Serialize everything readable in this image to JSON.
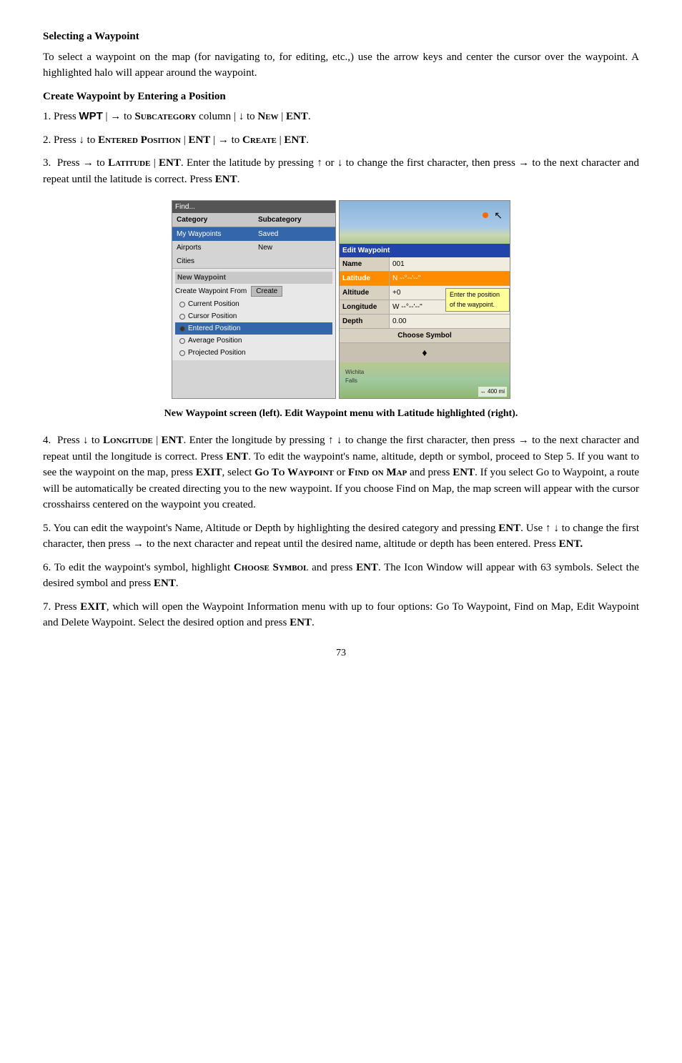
{
  "page": {
    "title": "Selecting a Waypoint",
    "section1": {
      "heading": "Selecting a Waypoint",
      "body": "To select a waypoint on the map (for navigating to, for editing, etc.,) use the arrow keys and center the cursor over the waypoint. A highlighted halo will appear around the waypoint."
    },
    "section2": {
      "heading": "Create Waypoint by Entering a Position",
      "step1": "1. Press WPT | → to Subcategory column | ↓ to New | ENT.",
      "step2": "2. Press ↓ to Entered Position | ENT | → to Create | ENT.",
      "step3_pre": "3.  Press → to",
      "step3_field": "Latitude | ENT",
      "step3_mid": ". Enter the latitude by pressing ↑ or ↓ to change the first character, then press → to the next character and repeat until the latitude is correct. Press",
      "step3_ent": "ENT",
      "step3_end": "."
    },
    "screenshot": {
      "left_panel": {
        "header": "Find...",
        "col1": "Category",
        "col2": "Subcategory",
        "rows": [
          {
            "cat": "My Waypoints",
            "sub": "Saved"
          },
          {
            "cat": "Airports",
            "sub": "New"
          },
          {
            "cat": "Cities",
            "sub": ""
          }
        ],
        "new_waypoint_title": "New Waypoint",
        "create_from_label": "Create Waypoint From",
        "create_button": "Create",
        "options": [
          {
            "label": "Current Position",
            "type": "radio"
          },
          {
            "label": "Cursor Position",
            "type": "radio"
          },
          {
            "label": "Entered Position",
            "type": "radio",
            "selected": true
          },
          {
            "label": "Average Position",
            "type": "radio"
          },
          {
            "label": "Projected Position",
            "type": "radio"
          }
        ]
      },
      "right_panel": {
        "edit_bar": "Edit Waypoint",
        "tooltip": "Enter the position of the waypoint.",
        "fields": [
          {
            "label": "Name",
            "value": "001"
          },
          {
            "label": "Altitude",
            "value": "+0"
          },
          {
            "label": "Depth",
            "value": "0.00"
          },
          {
            "label": "Latitude",
            "value": "N  --°--'--\"",
            "highlighted": true
          },
          {
            "label": "Longitude",
            "value": "W  --°--'--\""
          }
        ],
        "choose_symbol": "Choose Symbol",
        "symbol_icon": "♦",
        "map_labels": [
          "Wichita",
          "Falls"
        ]
      }
    },
    "caption": "New Waypoint screen (left). Edit Waypoint menu with Latitude highlighted (right).",
    "step4": "4. Press ↓ to Longitude | ENT. Enter the longitude by pressing ↑ ↓ to change the first character, then press → to the next character and repeat until the longitude is correct. Press ENT. To edit the waypoint's name, altitude, depth or symbol, proceed to Step 5. If you want to see the waypoint on the map, press EXIT, select Go To Waypoint or Find on Map and press ENT. If you select Go to Waypoint, a route will be automatically be created directing you to the new waypoint. If you choose Find on Map, the map screen will appear with the cursor crosshairss centered on the waypoint you created.",
    "step5": "5. You can edit the waypoint's Name, Altitude or Depth by highlighting the desired category and pressing ENT. Use ↑ ↓ to change the first character, then press → to the next character and repeat until the desired name, altitude or depth has been entered. Press ENT.",
    "step6_pre": "6. To edit the waypoint's symbol, highlight",
    "step6_field": "Choose Symbol",
    "step6_mid": "and press ENT. The Icon Window will appear with 63 symbols. Select the desired symbol and press",
    "step6_ent": "ENT",
    "step6_end": ".",
    "step7": "7. Press EXIT, which will open the Waypoint Information menu with up to four options: Go To Waypoint, Find on Map, Edit Waypoint and Delete Waypoint. Select the desired option and press ENT.",
    "page_number": "73"
  }
}
